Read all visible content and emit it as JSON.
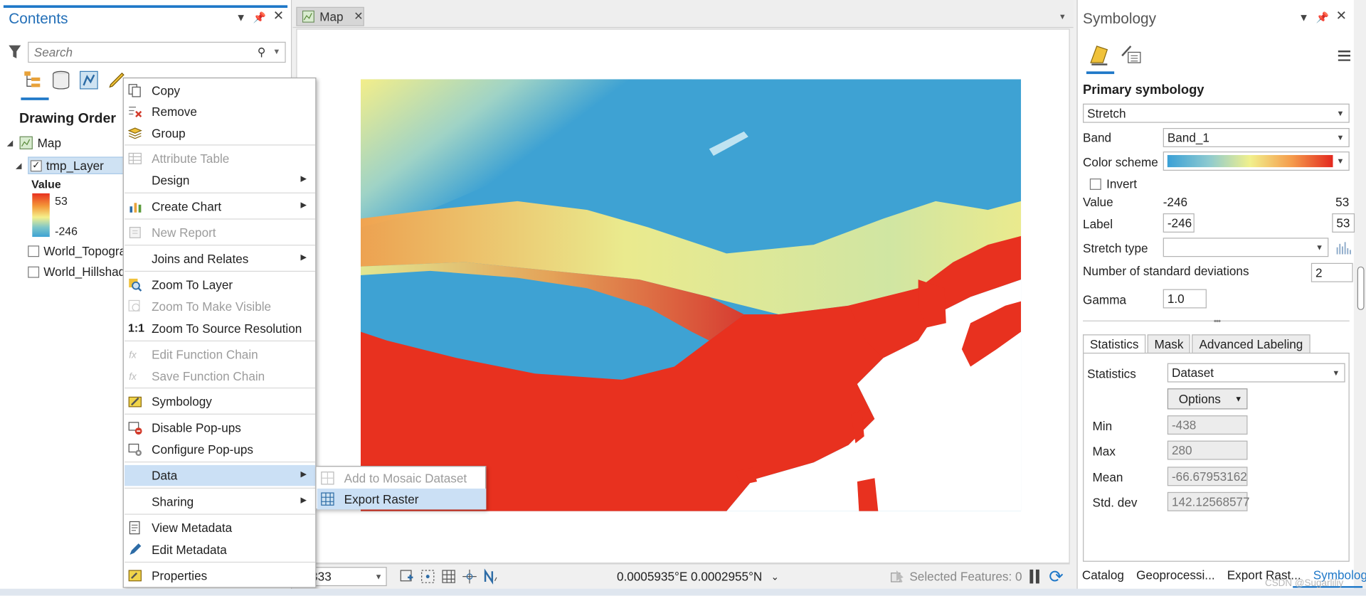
{
  "contents": {
    "title": "Contents",
    "search_placeholder": "Search",
    "drawing_order": "Drawing Order",
    "map_label": "Map",
    "layers": [
      {
        "name": "tmp_Layer",
        "checked": true
      },
      {
        "name": "World_Topogra",
        "checked": false
      },
      {
        "name": "World_Hillshad",
        "checked": false
      }
    ],
    "legend": {
      "heading": "Value",
      "high": "53",
      "low": "-246"
    }
  },
  "map": {
    "tab_label": "Map",
    "scale_value": "333",
    "coordinates": "0.0005935°E 0.0002955°N",
    "selected_features": "Selected Features: 0"
  },
  "context_menu": {
    "copy": "Copy",
    "remove": "Remove",
    "group": "Group",
    "attribute_table": "Attribute Table",
    "design": "Design",
    "create_chart": "Create Chart",
    "new_report": "New Report",
    "joins_relates": "Joins and Relates",
    "zoom_to_layer": "Zoom To Layer",
    "zoom_visible": "Zoom To Make Visible",
    "zoom_source": "Zoom To Source Resolution",
    "edit_function": "Edit Function Chain",
    "save_function": "Save Function Chain",
    "symbology": "Symbology",
    "disable_popups": "Disable Pop-ups",
    "configure_popups": "Configure Pop-ups",
    "data": "Data",
    "sharing": "Sharing",
    "view_metadata": "View Metadata",
    "edit_metadata": "Edit Metadata",
    "properties": "Properties",
    "ratio_glyph": "1:1"
  },
  "submenu": {
    "add_mosaic": "Add to Mosaic Dataset",
    "export_raster": "Export Raster"
  },
  "symbology": {
    "title": "Symbology",
    "primary": "Primary symbology",
    "renderer": "Stretch",
    "band_label": "Band",
    "band_value": "Band_1",
    "color_scheme_label": "Color scheme",
    "invert_label": "Invert",
    "value_label": "Value",
    "value_min": "-246",
    "value_max": "53",
    "label_label": "Label",
    "label_min": "-246",
    "label_max": "53",
    "stretch_type_label": "Stretch type",
    "stretch_type_value": "",
    "nstd_label": "Number of standard deviations",
    "nstd_value": "2",
    "gamma_label": "Gamma",
    "gamma_value": "1.0",
    "tabs": [
      "Statistics",
      "Mask",
      "Advanced Labeling"
    ],
    "statistics_label": "Statistics",
    "statistics_value": "Dataset",
    "options": "Options",
    "min_label": "Min",
    "min_value": "-438",
    "max_label": "Max",
    "max_value": "280",
    "mean_label": "Mean",
    "mean_value": "-66.67953162",
    "std_label": "Std. dev",
    "std_value": "142.12568577"
  },
  "bottom_tabs": [
    "Catalog",
    "Geoprocessi...",
    "Export Rast...",
    "Symbology"
  ],
  "watermark": "CSDN @Sugarliliy",
  "colors": {
    "accent": "#1f78c8",
    "high": "#e8311f",
    "mid": "#f1f08c",
    "low": "#3aa0d6"
  }
}
